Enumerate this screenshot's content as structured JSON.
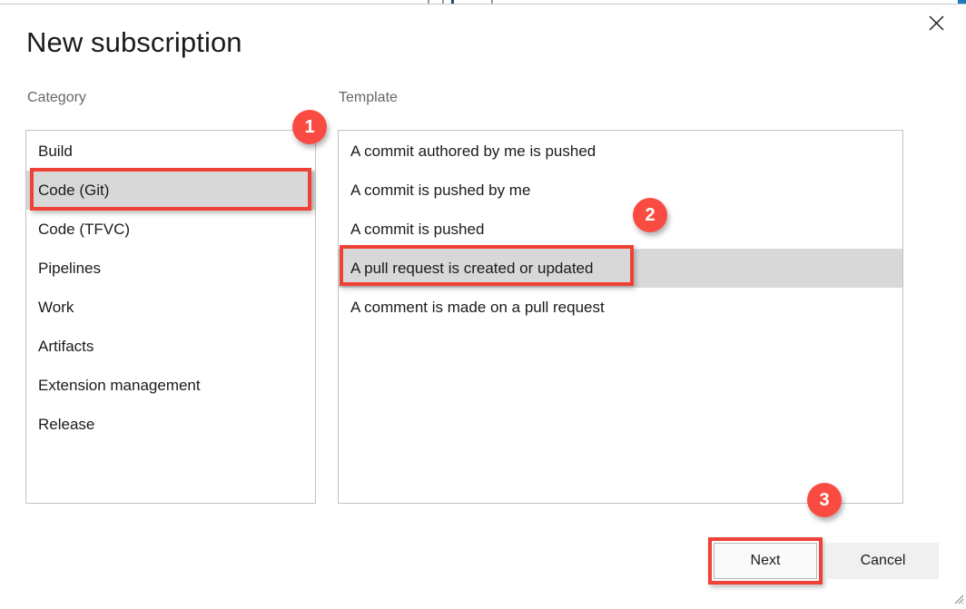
{
  "dialog": {
    "title": "New subscription",
    "close_icon": "close-icon"
  },
  "labels": {
    "category": "Category",
    "template": "Template"
  },
  "category_list": {
    "items": [
      {
        "label": "Build",
        "selected": false
      },
      {
        "label": "Code (Git)",
        "selected": true
      },
      {
        "label": "Code (TFVC)",
        "selected": false
      },
      {
        "label": "Pipelines",
        "selected": false
      },
      {
        "label": "Work",
        "selected": false
      },
      {
        "label": "Artifacts",
        "selected": false
      },
      {
        "label": "Extension management",
        "selected": false
      },
      {
        "label": "Release",
        "selected": false
      }
    ]
  },
  "template_list": {
    "items": [
      {
        "label": "A commit authored by me is pushed",
        "selected": false
      },
      {
        "label": "A commit is pushed by me",
        "selected": false
      },
      {
        "label": "A commit is pushed",
        "selected": false
      },
      {
        "label": "A pull request is created or updated",
        "selected": true
      },
      {
        "label": "A comment is made on a pull request",
        "selected": false
      }
    ]
  },
  "footer": {
    "next_label": "Next",
    "cancel_label": "Cancel"
  },
  "annotations": {
    "badges": [
      {
        "number": "1"
      },
      {
        "number": "2"
      },
      {
        "number": "3"
      }
    ],
    "highlight_color": "#ef4136",
    "badge_color": "#fa4b42"
  }
}
